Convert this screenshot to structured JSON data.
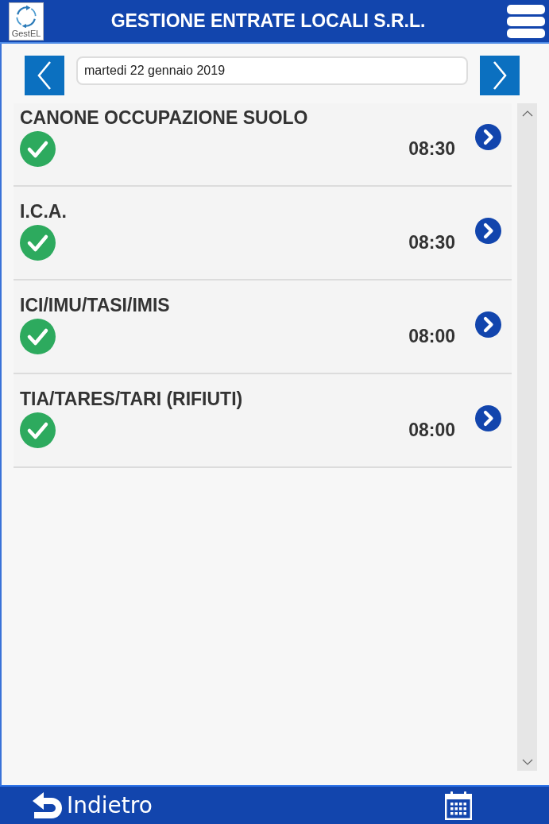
{
  "header": {
    "logo_text": "GestEL",
    "title": "GESTIONE ENTRATE LOCALI S.R.L."
  },
  "date_nav": {
    "date": "martedi 22 gennaio 2019"
  },
  "entries": [
    {
      "title": "CANONE OCCUPAZIONE SUOLO",
      "done": true,
      "time": "08:30"
    },
    {
      "title": "I.C.A.",
      "done": true,
      "time": "08:30"
    },
    {
      "title": "ICI/IMU/TASI/IMIS",
      "done": true,
      "time": "08:00"
    },
    {
      "title": "TIA/TARES/TARI (RIFIUTI)",
      "done": true,
      "time": "08:00"
    }
  ],
  "footer": {
    "back_label": "Indietro"
  }
}
